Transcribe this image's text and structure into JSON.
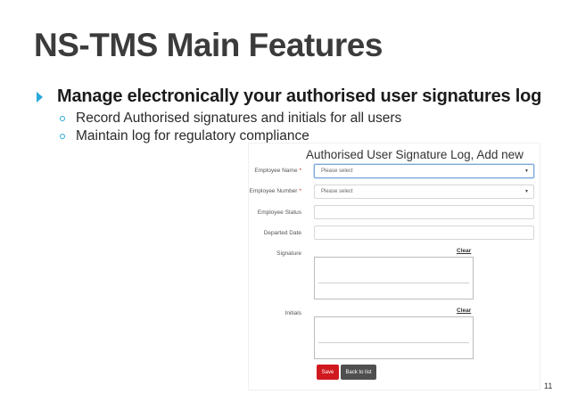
{
  "slide": {
    "title": "NS-TMS Main Features",
    "main_bullet": "Manage electronically your authorised user signatures log",
    "sub_bullets": [
      "Record Authorised signatures and initials for all users",
      "Maintain log for regulatory compliance"
    ],
    "page_number": "11",
    "accent_color": "#29a9d8"
  },
  "form": {
    "title": "Authorised User Signature Log, Add new",
    "employee_name": {
      "label": "Employee Name",
      "required_mark": "*",
      "value": "Please select"
    },
    "employee_number": {
      "label": "Employee Number",
      "required_mark": "*",
      "value": "Please select"
    },
    "employee_status": {
      "label": "Employee Status",
      "value": ""
    },
    "departed_date": {
      "label": "Departed Date",
      "value": ""
    },
    "signature": {
      "label": "Signature",
      "clear_label": "Clear"
    },
    "initials": {
      "label": "Initials",
      "clear_label": "Clear"
    },
    "save_label": "Save",
    "back_label": "Back to list",
    "save_color": "#d0191f",
    "back_color": "#4f4f4f"
  },
  "icons": {
    "bullet": "triangle-bullet-icon",
    "sub_bullet": "circle-bullet-icon",
    "dropdown": "caret-down-icon"
  }
}
